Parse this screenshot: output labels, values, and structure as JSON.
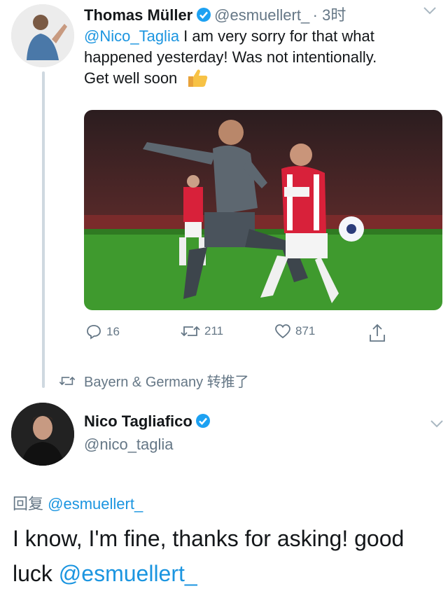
{
  "tweet1": {
    "name": "Thomas Müller",
    "handle": "@esmuellert_",
    "time": "· 3时",
    "mention": "@Nico_Taglia",
    "text_line1": " I am very sorry for that what",
    "text_line2": "happened yesterday! Was not intentionally.",
    "text_line3": "Get well soon",
    "emoji": "thumbs-up",
    "replies": "16",
    "retweets": "211",
    "likes": "871"
  },
  "retweet_notice": {
    "text": "Bayern & Germany 转推了"
  },
  "tweet2": {
    "name": "Nico Tagliafico",
    "handle": "@nico_taglia",
    "reply_prefix": "回复 ",
    "reply_to": "@esmuellert_",
    "text_line1": "I know, I'm fine, thanks for asking! good",
    "text_line2_prefix": "luck ",
    "text_line2_mention": "@esmuellert_"
  },
  "colors": {
    "link": "#1b95e0",
    "verified": "#1da1f2",
    "muted": "#657786",
    "pitch": "#3f9a2e"
  }
}
